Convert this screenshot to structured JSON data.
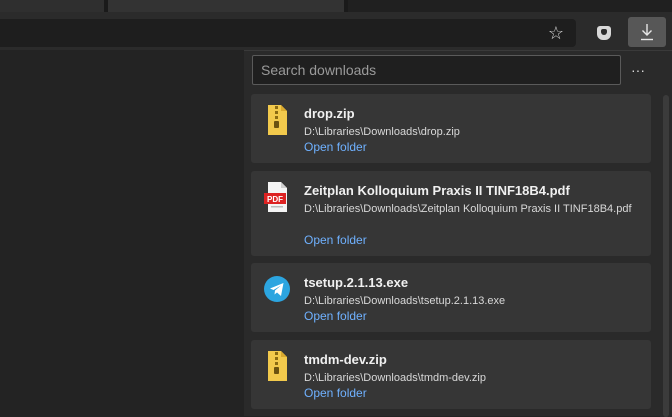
{
  "toolbar": {
    "icons": [
      "star-icon",
      "extension-shield-icon",
      "download-icon"
    ]
  },
  "downloads": {
    "search_placeholder": "Search downloads",
    "more_label": "···",
    "items": [
      {
        "icon": "zip-icon",
        "name": "drop.zip",
        "path": "D:\\Libraries\\Downloads\\drop.zip",
        "action": "Open folder"
      },
      {
        "icon": "pdf-icon",
        "name": "Zeitplan Kolloquium Praxis II TINF18B4.pdf",
        "path": "D:\\Libraries\\Downloads\\Zeitplan Kolloquium Praxis II TINF18B4.pdf",
        "action": "Open folder"
      },
      {
        "icon": "telegram-icon",
        "name": "tsetup.2.1.13.exe",
        "path": "D:\\Libraries\\Downloads\\tsetup.2.1.13.exe",
        "action": "Open folder"
      },
      {
        "icon": "zip-icon",
        "name": "tmdm-dev.zip",
        "path": "D:\\Libraries\\Downloads\\tmdm-dev.zip",
        "action": "Open folder"
      }
    ]
  },
  "colors": {
    "link": "#6fb1ff",
    "panel_bg": "#2a2a2a",
    "card_bg": "#363636",
    "active_button": "#575757",
    "zip_yellow": "#f2c94c",
    "pdf_red": "#d22",
    "telegram_blue": "#2ca5e0"
  }
}
